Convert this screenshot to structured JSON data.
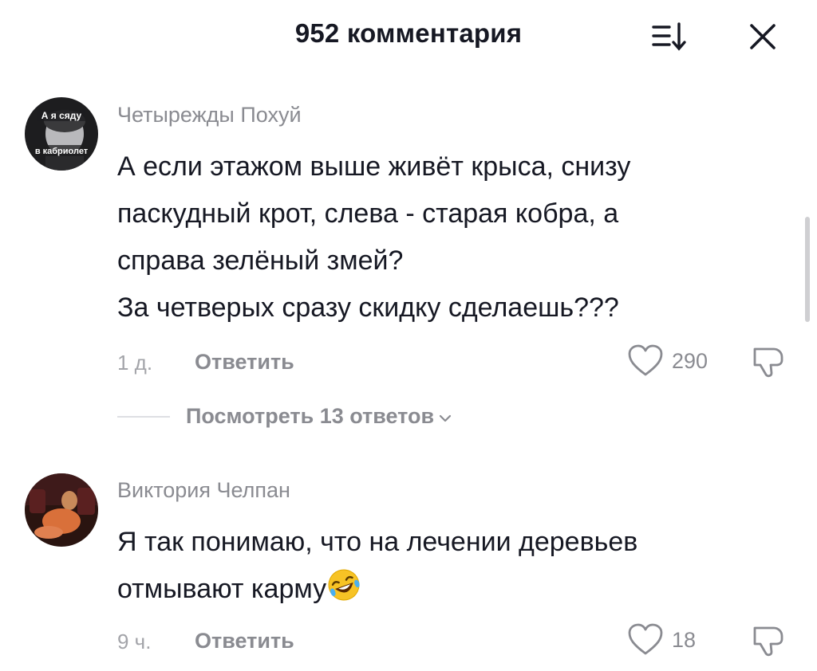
{
  "header": {
    "title": "952 комментария"
  },
  "comments": [
    {
      "username": "Четырежды Похуй",
      "avatar_text_top": "А я сяду",
      "avatar_text_bottom": "в кабриолет",
      "lines": [
        "А если этажом выше живёт крыса, снизу",
        "паскудный крот, слева - старая кобра, а",
        "справа зелёный змей?",
        "За четверых сразу скидку сделаешь???"
      ],
      "time": "1 д.",
      "reply_label": "Ответить",
      "likes": "290",
      "view_replies": "Посмотреть 13 ответов"
    },
    {
      "username": "Виктория Челпан",
      "lines": [
        "Я так понимаю, что на лечении деревьев",
        "отмывают карму"
      ],
      "time": "9 ч.",
      "reply_label": "Ответить",
      "likes": "18"
    }
  ],
  "colors": {
    "primary_text": "#161823",
    "secondary_text": "#8a8b91",
    "muted_text": "#a3a4a9",
    "background": "#ffffff"
  },
  "icons": {
    "sort": "sort-icon",
    "close": "close-icon",
    "like": "heart-icon",
    "dislike": "dislike-icon",
    "emoji": "rofl-emoji"
  }
}
